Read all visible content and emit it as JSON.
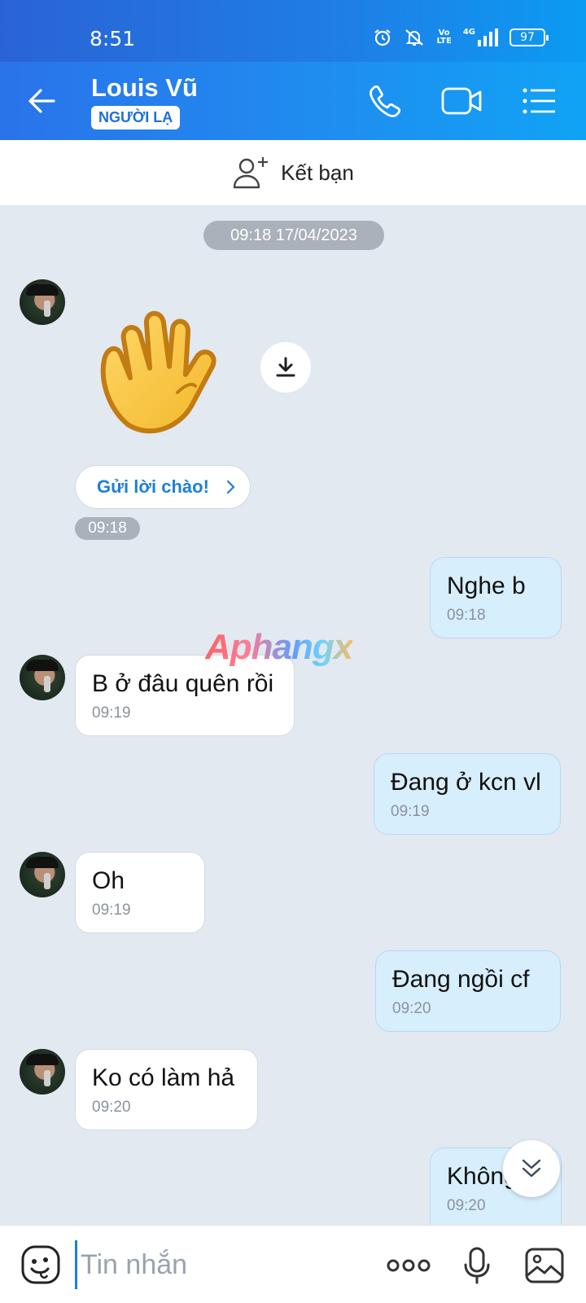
{
  "status_bar": {
    "time": "8:51",
    "battery": "97",
    "network": "4G",
    "volte_top": "Vo",
    "volte_bottom": "LTE"
  },
  "header": {
    "contact_name": "Louis Vũ",
    "badge": "NGƯỜI LẠ"
  },
  "friend_bar": {
    "label": "Kết bạn"
  },
  "chat": {
    "date_separator": "09:18 17/04/2023",
    "greet_button": "Gửi lời chào!",
    "sticker_time": "09:18",
    "messages": [
      {
        "direction": "out",
        "text": "Nghe b",
        "time": "09:18"
      },
      {
        "direction": "in",
        "text": "B ở đâu quên rồi",
        "time": "09:19"
      },
      {
        "direction": "out",
        "text": "Đang ở kcn vl",
        "time": "09:19"
      },
      {
        "direction": "in",
        "text": "Oh",
        "time": "09:19"
      },
      {
        "direction": "out",
        "text": "Đang ngồi cf",
        "time": "09:20"
      },
      {
        "direction": "in",
        "text": "Ko có làm hả",
        "time": "09:20"
      },
      {
        "direction": "out",
        "text": "Không",
        "time": "09:20"
      }
    ]
  },
  "watermark": "Aphangx",
  "input": {
    "placeholder": "Tin nhắn"
  }
}
